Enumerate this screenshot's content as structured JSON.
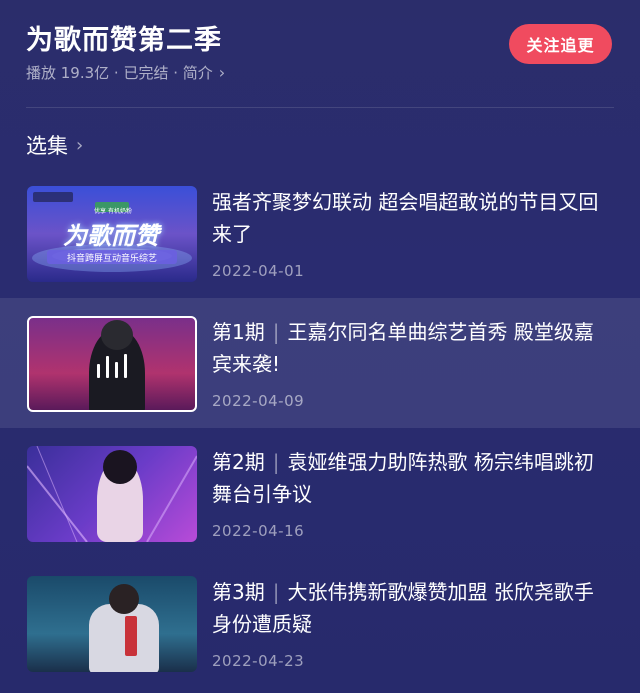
{
  "show": {
    "title": "为歌而赞第二季",
    "meta": "播放 19.3亿 · 已完结 · 简介",
    "meta_chevron": "›",
    "follow_label": "关注追更"
  },
  "section": {
    "label": "选集",
    "chevron": "›"
  },
  "episodes": [
    {
      "prefix": "",
      "title": "强者齐聚梦幻联动 超会唱超敢说的节目又回来了",
      "date": "2022-04-01",
      "active": false
    },
    {
      "prefix": "第1期",
      "title": "王嘉尔同名单曲综艺首秀 殿堂级嘉宾来袭!",
      "date": "2022-04-09",
      "active": true
    },
    {
      "prefix": "第2期",
      "title": "袁娅维强力助阵热歌 杨宗纬唱跳初舞台引争议",
      "date": "2022-04-16",
      "active": false
    },
    {
      "prefix": "第3期",
      "title": "大张伟携新歌爆赞加盟 张欣尧歌手身份遭质疑",
      "date": "2022-04-23",
      "active": false
    }
  ],
  "separator": "|",
  "thumb_logo_text": "为歌而赞",
  "thumb_banner_text": "抖音跨屏互动音乐综艺",
  "thumb_top_text": "优享 有机奶粉"
}
